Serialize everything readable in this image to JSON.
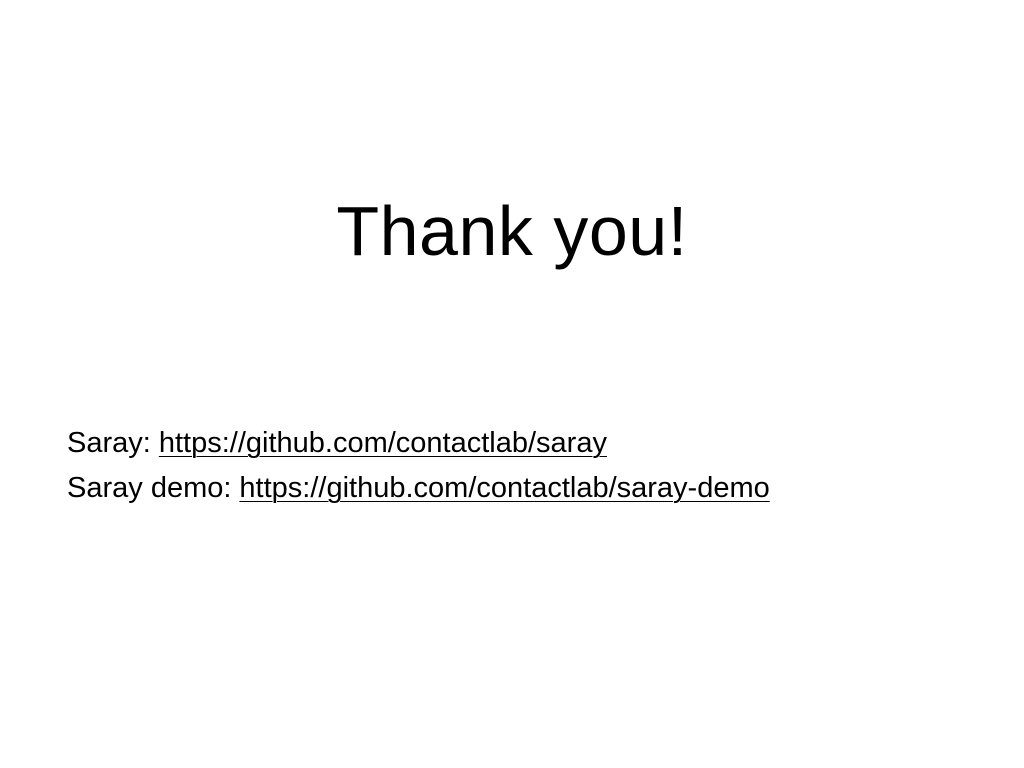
{
  "slide": {
    "title": "Thank you!",
    "links": [
      {
        "label": "Saray:",
        "url": "https://github.com/contactlab/saray"
      },
      {
        "label": "Saray demo:",
        "url": "https://github.com/contactlab/saray-demo"
      }
    ]
  },
  "colors": {
    "background": "#ffffff",
    "text": "#000000"
  }
}
